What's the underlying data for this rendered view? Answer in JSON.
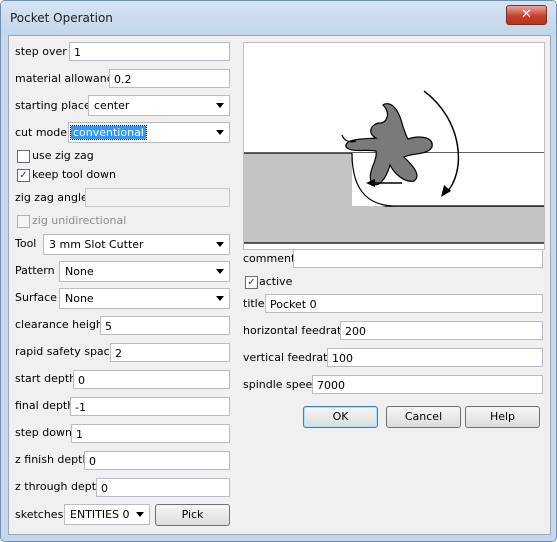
{
  "window": {
    "title": "Pocket Operation",
    "close_glyph": "✕"
  },
  "left": {
    "step_over": {
      "label": "step over",
      "value": "1"
    },
    "material_allowance": {
      "label": "material allowance",
      "value": "0.2"
    },
    "starting_place": {
      "label": "starting place",
      "value": "center"
    },
    "cut_mode": {
      "label": "cut mode",
      "value": "conventional"
    },
    "use_zig_zag": {
      "label": "use zig zag",
      "checked": false
    },
    "keep_tool_down": {
      "label": "keep tool down",
      "checked": true
    },
    "zig_zag_angle": {
      "label": "zig zag angle",
      "value": ""
    },
    "zig_unidirectional": {
      "label": "zig unidirectional",
      "checked": false,
      "disabled": true
    },
    "tool": {
      "label": "Tool",
      "value": "3 mm Slot Cutter"
    },
    "pattern": {
      "label": "Pattern",
      "value": "None"
    },
    "surface": {
      "label": "Surface",
      "value": "None"
    },
    "clearance_height": {
      "label": "clearance height",
      "value": "5"
    },
    "rapid_safety_space": {
      "label": "rapid safety space",
      "value": "2"
    },
    "start_depth": {
      "label": "start depth",
      "value": "0"
    },
    "final_depth": {
      "label": "final depth",
      "value": "-1"
    },
    "step_down": {
      "label": "step down",
      "value": "1"
    },
    "z_finish_depth": {
      "label": "z finish depth",
      "value": "0"
    },
    "z_through_depth": {
      "label": "z through depth",
      "value": "0"
    },
    "sketches": {
      "label": "sketches",
      "value": "ENTITIES 0",
      "pick_label": "Pick"
    }
  },
  "right": {
    "comment": {
      "label": "comment",
      "value": ""
    },
    "active": {
      "label": "active",
      "checked": true
    },
    "title": {
      "label": "title",
      "value": "Pocket 0"
    },
    "horizontal_feedrate": {
      "label": "horizontal feedrate",
      "value": "200"
    },
    "vertical_feedrate": {
      "label": "vertical feedrate",
      "value": "100"
    },
    "spindle_speed": {
      "label": "spindle speed",
      "value": "7000"
    }
  },
  "buttons": {
    "ok": "OK",
    "cancel": "Cancel",
    "help": "Help"
  },
  "check_glyph": "✓"
}
